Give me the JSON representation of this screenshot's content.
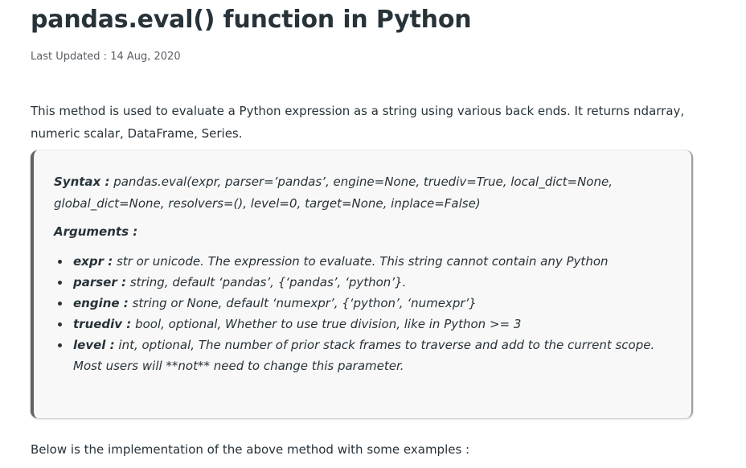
{
  "article": {
    "title": "pandas.eval() function in Python",
    "last_updated": "Last Updated : 14 Aug, 2020",
    "intro": "This method is used to evaluate a Python expression as a string using various back ends. It returns ndarray, numeric scalar, DataFrame, Series.",
    "syntax_label": "Syntax :",
    "syntax_text": " pandas.eval(expr, parser=’pandas’, engine=None, truediv=True, local_dict=None, global_dict=None, resolvers=(), level=0, target=None, inplace=False)",
    "arguments_label": "Arguments :",
    "arguments": [
      {
        "name": "expr :",
        "desc": " str or unicode. The expression to evaluate. This string cannot contain any Python"
      },
      {
        "name": "parser :",
        "desc": " string, default ‘pandas’, {‘pandas’, ‘python’}."
      },
      {
        "name": "engine :",
        "desc": " string or None, default ‘numexpr’, {‘python’, ‘numexpr’}"
      },
      {
        "name": "truediv :",
        "desc": " bool, optional, Whether to use true division, like in Python >= 3"
      },
      {
        "name": "level :",
        "desc": " int, optional, The number of prior stack frames to traverse and add to the current scope. Most users will **not** need to change this parameter."
      }
    ],
    "outro": "Below is the implementation of the above method with some examples :"
  }
}
